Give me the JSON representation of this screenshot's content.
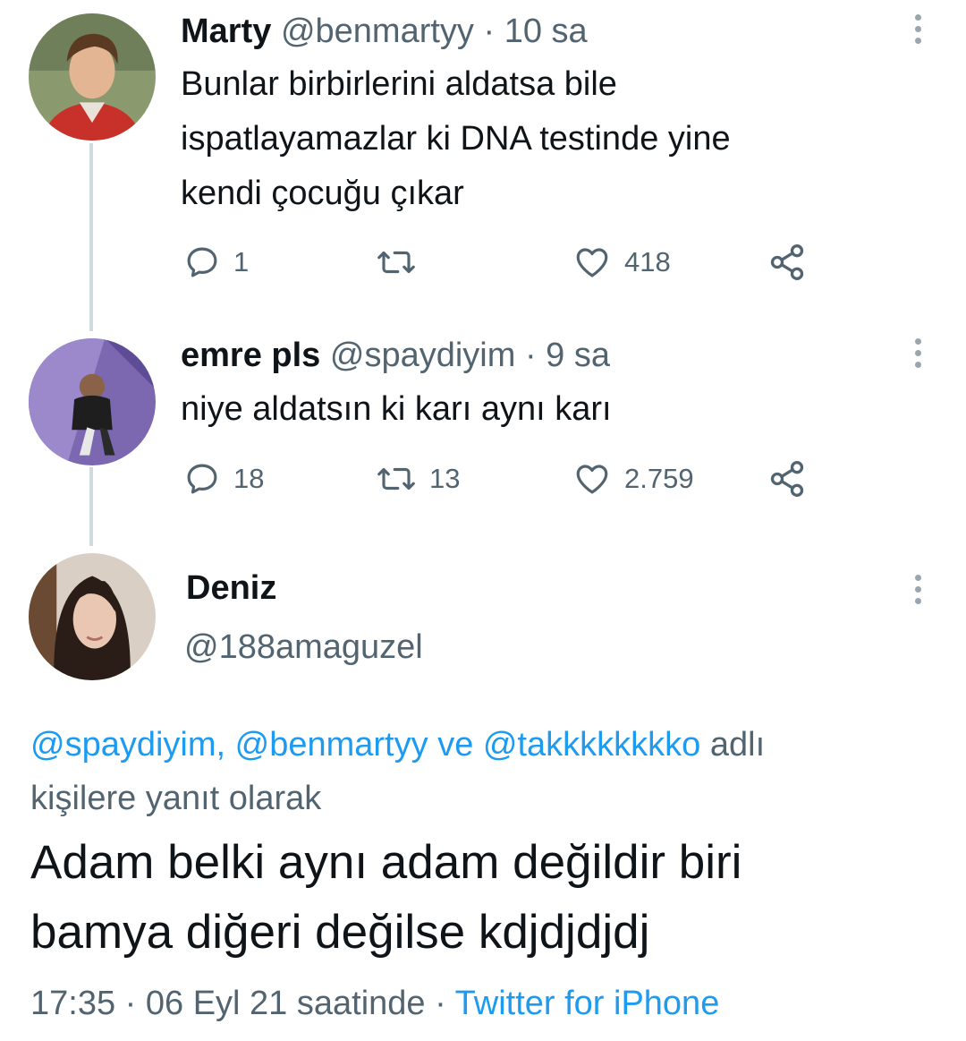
{
  "tweets": [
    {
      "name": "Marty",
      "handle": "@benmartyy",
      "separator": "·",
      "time": "10 sa",
      "text_lines": [
        "Bunlar birbirlerini aldatsa bile",
        "ispatlayamazlar ki DNA testinde yine",
        "kendi çocuğu çıkar"
      ],
      "actions": {
        "reply_count": "1",
        "retweet_count": "",
        "like_count": "418"
      },
      "icons": [
        "reply-icon",
        "retweet-icon",
        "like-icon",
        "share-icon",
        "more-options-icon"
      ]
    },
    {
      "name": "emre pls",
      "handle": "@spaydiyim",
      "separator": "·",
      "time": "9 sa",
      "text_lines": [
        "niye aldatsın ki karı aynı karı"
      ],
      "actions": {
        "reply_count": "18",
        "retweet_count": "13",
        "like_count": "2.759"
      },
      "icons": [
        "reply-icon",
        "retweet-icon",
        "like-icon",
        "share-icon",
        "more-options-icon"
      ]
    }
  ],
  "main_tweet": {
    "name": "Deniz",
    "handle": "@188amaguzel",
    "reply_to": {
      "mentions": [
        "@spaydiyim,",
        "@benmartyy",
        "@takkkkkkkko"
      ],
      "connector": "ve",
      "suffix_line1": "adlı",
      "suffix_line2": "kişilere yanıt olarak"
    },
    "text_lines": [
      "Adam belki aynı adam değildir biri",
      "bamya diğeri değilse kdjdjdjdj"
    ],
    "meta": {
      "time": "17:35",
      "separator": "·",
      "date": "06 Eyl 21 saatinde",
      "source": "Twitter for iPhone"
    }
  },
  "colors": {
    "accent": "#1d9bf0",
    "secondary_text": "#536471",
    "thread_line": "#cfd9de"
  }
}
